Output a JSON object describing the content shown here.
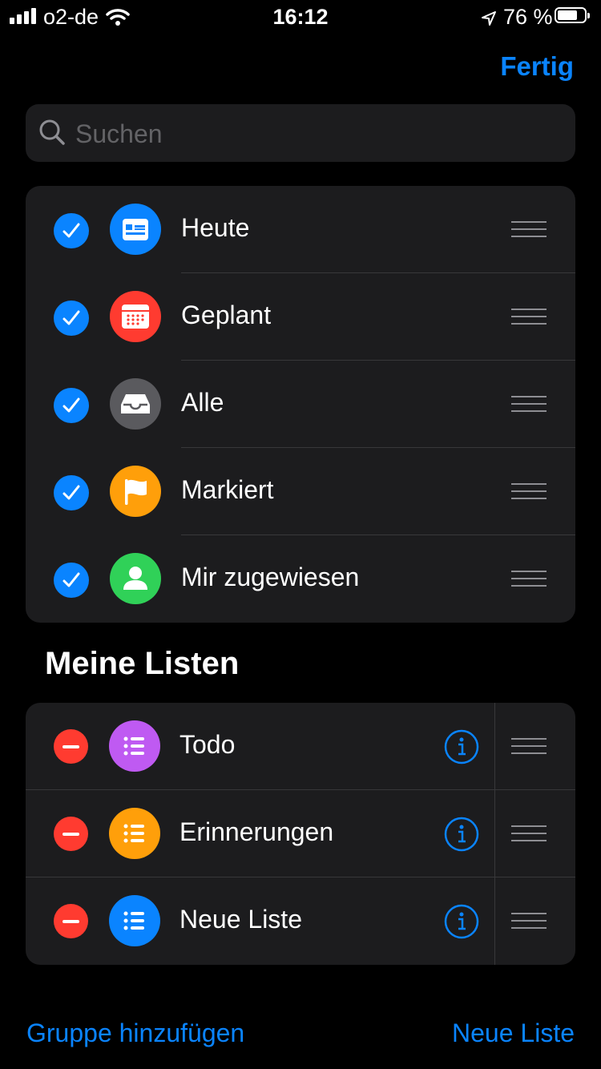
{
  "status": {
    "carrier": "o2-de",
    "time": "16:12",
    "battery_pct_text": "76 %",
    "battery_level": 0.76,
    "signal_bars": 4
  },
  "nav": {
    "done_label": "Fertig"
  },
  "search": {
    "placeholder": "Suchen",
    "value": ""
  },
  "smart_lists": [
    {
      "label": "Heute",
      "icon": "calendar-today-icon",
      "color": "#0a84ff",
      "checked": true
    },
    {
      "label": "Geplant",
      "icon": "calendar-grid-icon",
      "color": "#ff3b30",
      "checked": true
    },
    {
      "label": "Alle",
      "icon": "tray-icon",
      "color": "#5a5a5e",
      "checked": true
    },
    {
      "label": "Markiert",
      "icon": "flag-icon",
      "color": "#ff9f0a",
      "checked": true
    },
    {
      "label": "Mir zugewiesen",
      "icon": "person-icon",
      "color": "#30d158",
      "checked": true
    }
  ],
  "my_lists": {
    "title": "Meine Listen",
    "items": [
      {
        "label": "Todo",
        "icon": "list-bullet-icon",
        "color": "#bf5af2"
      },
      {
        "label": "Erinnerungen",
        "icon": "list-bullet-icon",
        "color": "#ff9f0a"
      },
      {
        "label": "Neue Liste",
        "icon": "list-bullet-icon",
        "color": "#0a84ff"
      }
    ]
  },
  "footer": {
    "add_group_label": "Gruppe hinzufügen",
    "new_list_label": "Neue Liste"
  },
  "colors": {
    "accent": "#0a84ff",
    "card_bg": "#1c1c1e",
    "separator": "#38383a",
    "delete": "#ff3b30"
  }
}
